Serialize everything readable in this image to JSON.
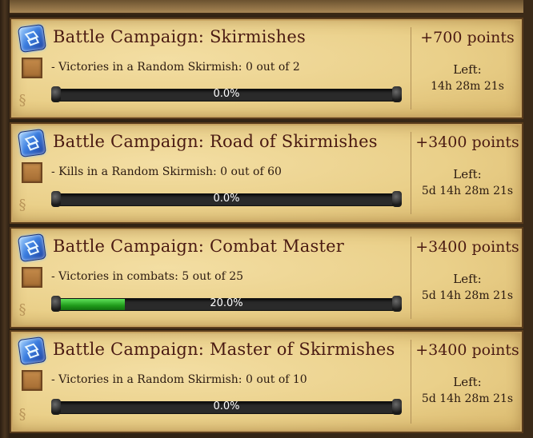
{
  "quests": [
    {
      "title": "Battle Campaign: Skirmishes",
      "objective": "- Victories in a Random Skirmish: 0 out of 2",
      "progress_label": "0.0%",
      "progress_fraction": 0.0,
      "points": "+700 points",
      "left_label": "Left:",
      "left_time": "14h 28m 21s"
    },
    {
      "title": "Battle Campaign: Road of Skirmishes",
      "objective": "- Kills in a Random Skirmish: 0  out of 60",
      "progress_label": "0.0%",
      "progress_fraction": 0.0,
      "points": "+3400 points",
      "left_label": "Left:",
      "left_time": "5d 14h 28m 21s"
    },
    {
      "title": "Battle Campaign: Combat Master",
      "objective": "- Victories in combats: 5 out of 25",
      "progress_label": "20.0%",
      "progress_fraction": 0.2,
      "points": "+3400 points",
      "left_label": "Left:",
      "left_time": "5d 14h 28m 21s"
    },
    {
      "title": "Battle Campaign: Master of Skirmishes",
      "objective": "- Victories in a Random Skirmish: 0  out of 10",
      "progress_label": "0.0%",
      "progress_fraction": 0.0,
      "points": "+3400 points",
      "left_label": "Left:",
      "left_time": "5d 14h 28m 21s"
    }
  ],
  "icons": {
    "quest": "campaign-scroll-icon",
    "checkbox": "checkbox-icon"
  },
  "colors": {
    "title": "#4a1a12",
    "progress_fill": "#1f9a1a",
    "parchment": "#ead08a"
  }
}
